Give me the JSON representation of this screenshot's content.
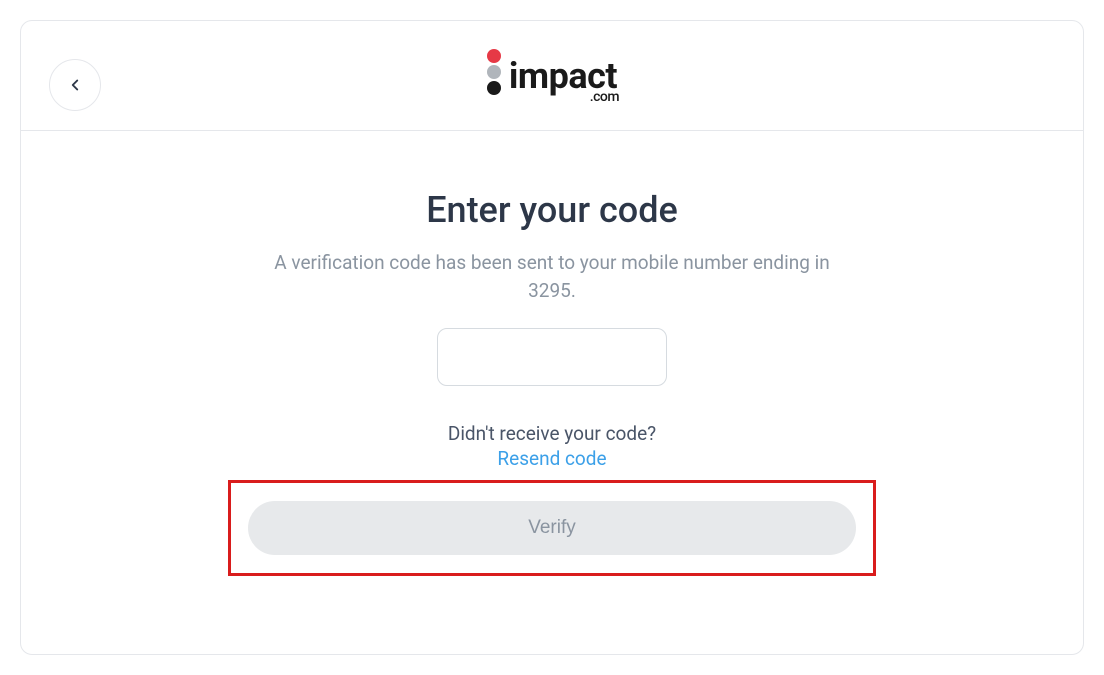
{
  "logo": {
    "name": "impact",
    "suffix": ".com"
  },
  "page": {
    "title": "Enter your code",
    "subtitle": "A verification code has been sent to your mobile number ending in 3295."
  },
  "code_input": {
    "value": ""
  },
  "resend": {
    "question": "Didn't receive your code?",
    "link_text": "Resend code"
  },
  "verify": {
    "label": "Verify"
  }
}
